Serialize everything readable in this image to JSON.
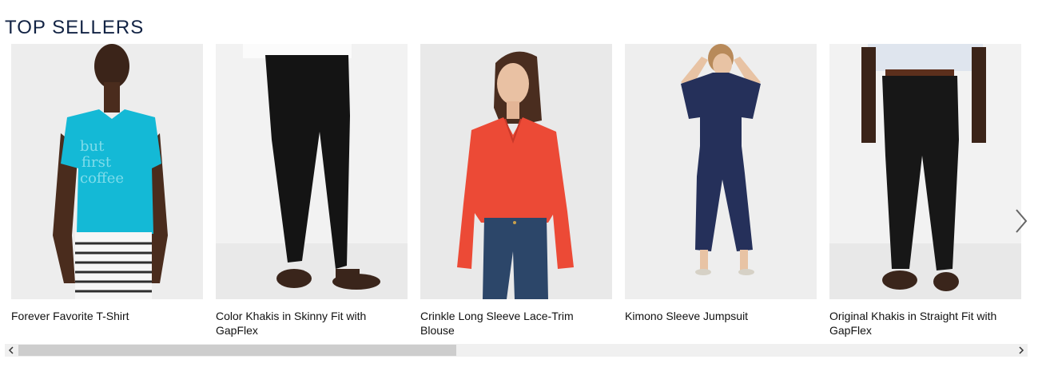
{
  "section": {
    "title": "TOP SELLERS"
  },
  "products": [
    {
      "name": "Forever Favorite T-Shirt",
      "image": "woman-turquoise-tshirt-striped-pants"
    },
    {
      "name": "Color Khakis in Skinny Fit with GapFlex",
      "image": "man-black-skinny-pants"
    },
    {
      "name": "Crinkle Long Sleeve Lace-Trim Blouse",
      "image": "woman-red-blouse-jeans"
    },
    {
      "name": "Kimono Sleeve Jumpsuit",
      "image": "woman-navy-jumpsuit"
    },
    {
      "name": "Original Khakis in Straight Fit with GapFlex",
      "image": "man-black-straight-pants"
    }
  ],
  "carousel": {
    "next_icon": "chevron-right-icon"
  },
  "scrollbar": {
    "left_icon": "scroll-left-arrow-icon",
    "right_icon": "scroll-right-arrow-icon",
    "position_fraction": 0.0,
    "visible_fraction": 0.44
  },
  "colors": {
    "title": "#122344",
    "image_bg": "#ececec",
    "scroll_track": "#f0f0f0",
    "scroll_thumb": "#cdcdcd"
  }
}
